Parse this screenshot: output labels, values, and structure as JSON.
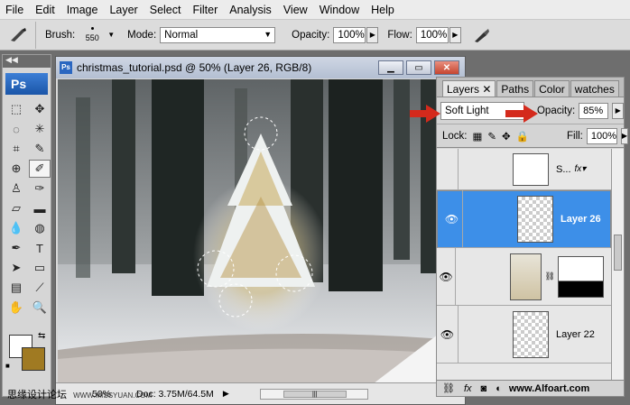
{
  "menu": [
    "File",
    "Edit",
    "Image",
    "Layer",
    "Select",
    "Filter",
    "Analysis",
    "View",
    "Window",
    "Help"
  ],
  "options": {
    "brush_label": "Brush:",
    "brush_size": "550",
    "mode_label": "Mode:",
    "mode_value": "Normal",
    "opacity_label": "Opacity:",
    "opacity_value": "100%",
    "flow_label": "Flow:",
    "flow_value": "100%"
  },
  "toolbox": {
    "logo": "Ps"
  },
  "document": {
    "title": "christmas_tutorial.psd @ 50% (Layer 26, RGB/8)",
    "zoom": "50%",
    "doc_info": "Doc: 3.75M/64.5M"
  },
  "layers_panel": {
    "tabs": [
      "Layers",
      "Paths",
      "Color",
      "watches"
    ],
    "blend_mode": "Soft Light",
    "opacity_label": "Opacity:",
    "opacity_value": "85%",
    "lock_label": "Lock:",
    "fill_label": "Fill:",
    "fill_value": "100%",
    "layers": [
      {
        "name": "S...",
        "selected": false,
        "visible": false
      },
      {
        "name": "Layer 26",
        "selected": true,
        "visible": true
      },
      {
        "name": "",
        "selected": false,
        "visible": true
      },
      {
        "name": "Layer 22",
        "selected": false,
        "visible": true
      }
    ]
  },
  "watermarks": {
    "left": "思缘设计论坛",
    "left_site": "WWW.MISSYUAN.COM",
    "right": "www.Alfoart.com"
  },
  "colors": {
    "accent": "#3d8fe8",
    "arrow": "#d42a1c",
    "background_swatch": "#a07a22"
  }
}
